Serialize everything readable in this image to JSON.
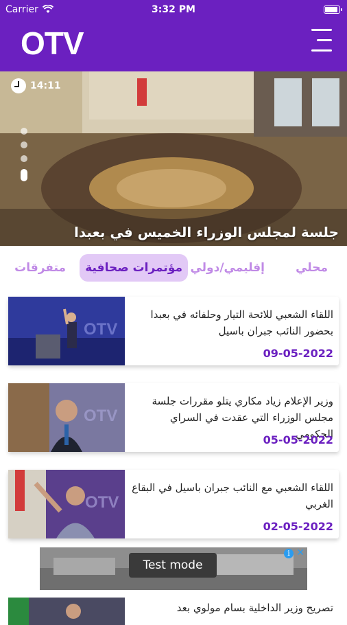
{
  "status_bar": {
    "carrier": "Carrier",
    "time": "3:32 PM"
  },
  "header": {
    "logo": "OTV"
  },
  "hero": {
    "time": "14:11",
    "title": "جلسة لمجلس الوزراء الخميس في بعبدا"
  },
  "tabs": [
    {
      "label": "محلي"
    },
    {
      "label": "إقليمي/دولي"
    },
    {
      "label": "مؤتمرات صحافية",
      "active": true
    },
    {
      "label": "متفرقات"
    }
  ],
  "articles": [
    {
      "title": "اللقاء الشعبي للائحة التيار وحلفائه في بعبدا بحضور النائب جبران باسيل",
      "date": "09-05-2022"
    },
    {
      "title": "وزير الإعلام زياد مكاري يتلو مقررات جلسة مجلس الوزراء التي عقدت في السراي الحكومي",
      "date": "05-05-2022"
    },
    {
      "title": "اللقاء الشعبي مع النائب جبران باسيل في البقاع الغربي",
      "date": "02-05-2022"
    }
  ],
  "ad": {
    "label": "Test mode",
    "info": "i",
    "close": "✕"
  },
  "partial_article": {
    "title": "تصريح وزير الداخلية بسام مولوي بعد"
  },
  "thumb_watermark": "OTV",
  "colors": {
    "brand": "#6b20c0",
    "tab_inactive": "#c08ae6",
    "tab_active_bg": "#e2c9f6"
  }
}
